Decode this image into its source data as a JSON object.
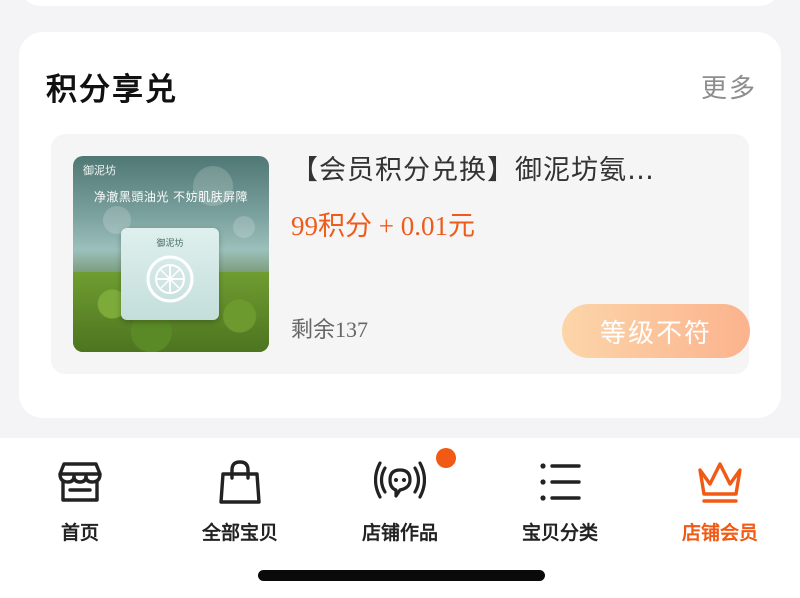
{
  "section": {
    "title": "积分享兑",
    "more_label": "更多"
  },
  "product": {
    "title": "【会员积分兑换】御泥坊氨…",
    "price": "99积分 + 0.01元",
    "stock": "剩余137",
    "button_label": "等级不符",
    "image": {
      "brand": "御泥坊",
      "tagline": "净澈黑頭油光 不妨肌肤屏障",
      "box_label": "御泥坊"
    }
  },
  "tabs": [
    {
      "label": "首页",
      "icon": "storefront-icon",
      "active": false
    },
    {
      "label": "全部宝贝",
      "icon": "shopping-bag-icon",
      "active": false
    },
    {
      "label": "店铺作品",
      "icon": "live-broadcast-icon",
      "active": false,
      "badge": true
    },
    {
      "label": "宝贝分类",
      "icon": "category-list-icon",
      "active": false
    },
    {
      "label": "店铺会员",
      "icon": "crown-icon",
      "active": true
    }
  ],
  "colors": {
    "accent": "#f05a14",
    "price": "#ef5b1b",
    "button_gradient_start": "#fcd5a9",
    "button_gradient_end": "#fbb38d"
  }
}
